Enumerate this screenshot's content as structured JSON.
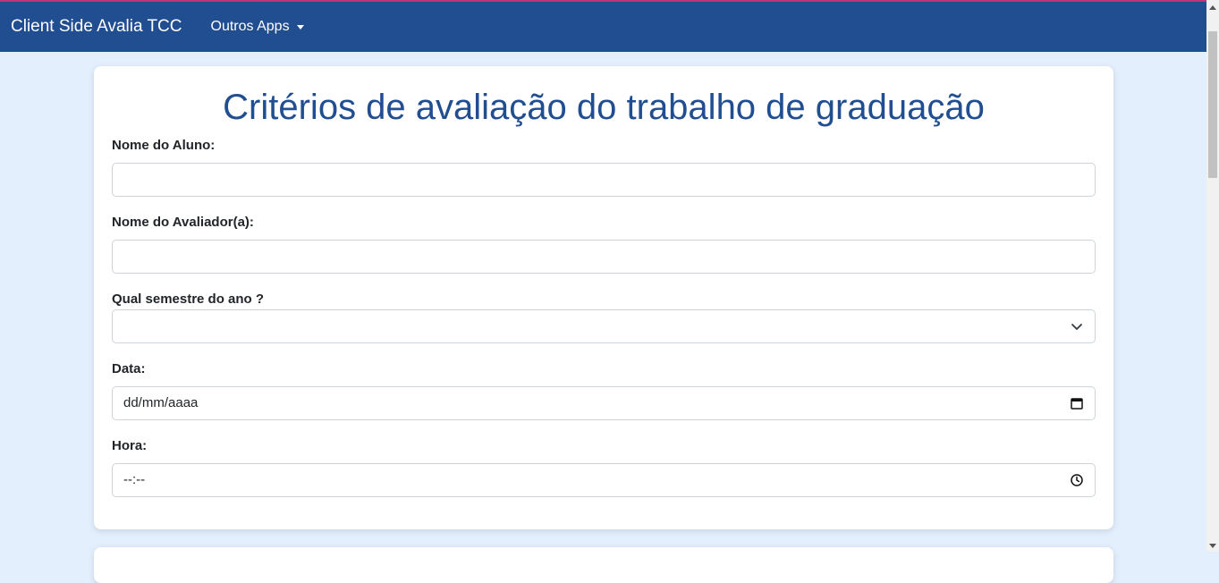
{
  "navbar": {
    "brand": "Client Side Avalia TCC",
    "dropdown_label": "Outros Apps"
  },
  "form": {
    "title": "Critérios de avaliação do trabalho de graduação",
    "aluno_label": "Nome do Aluno:",
    "aluno_value": "",
    "avaliador_label": "Nome do Avaliador(a):",
    "avaliador_value": "",
    "semestre_label": "Qual semestre do ano ?",
    "semestre_selected": "",
    "data_label": "Data:",
    "data_placeholder": "dd/mm/aaaa",
    "hora_label": "Hora:",
    "hora_placeholder": "--:--"
  },
  "icons": {
    "select": "chevron-down-icon",
    "date": "calendar-icon",
    "time": "clock-icon"
  },
  "colors": {
    "navbar": "#214e91",
    "accent_line": "#c0347e",
    "background": "#e3effd",
    "title": "#214e91"
  }
}
